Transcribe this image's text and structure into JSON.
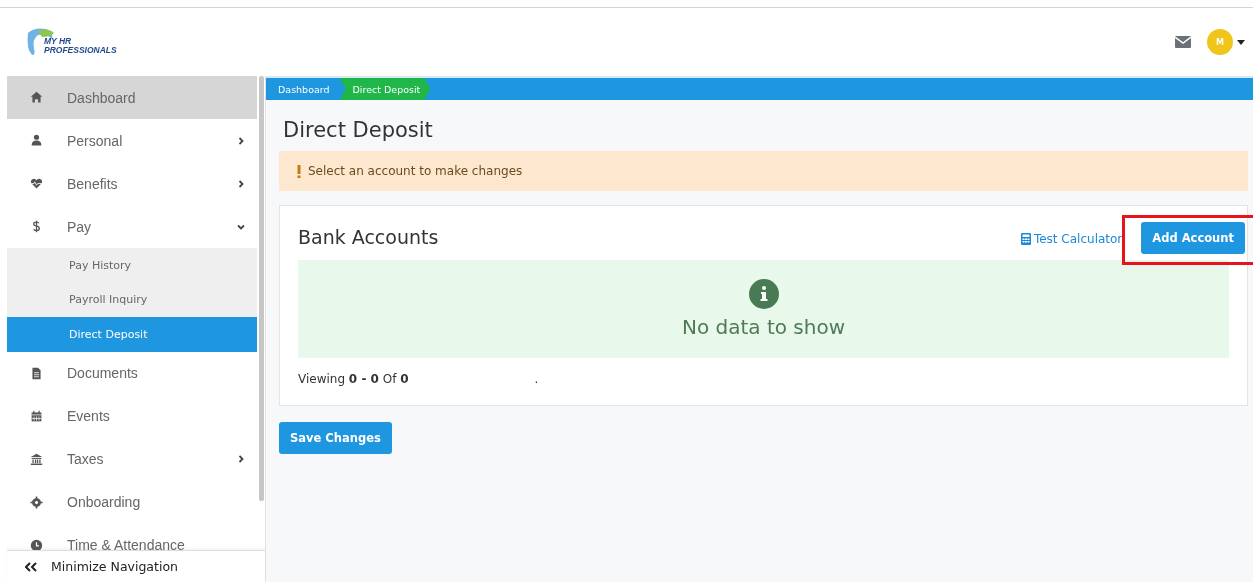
{
  "header": {
    "logo": {
      "line_1": "MY HR",
      "line_2": "PROFESSIONALS"
    },
    "avatar": "M"
  },
  "sidebar": {
    "items": [
      {
        "label": "Dashboard",
        "kind": "link",
        "highlighted": true,
        "selected": false
      },
      {
        "label": "Personal",
        "kind": "group",
        "expanded": false,
        "highlighted": false,
        "selected": false
      },
      {
        "label": "Benefits",
        "kind": "group",
        "expanded": false,
        "highlighted": false,
        "selected": false
      },
      {
        "label": "Pay",
        "kind": "group",
        "expanded": true,
        "highlighted": false,
        "selected": false,
        "children": [
          {
            "label": "Pay History",
            "selected": false
          },
          {
            "label": "Payroll Inquiry",
            "selected": false
          },
          {
            "label": "Direct Deposit",
            "selected": true
          }
        ]
      },
      {
        "label": "Documents",
        "kind": "link",
        "highlighted": false,
        "selected": false
      },
      {
        "label": "Events",
        "kind": "link",
        "highlighted": false,
        "selected": false
      },
      {
        "label": "Taxes",
        "kind": "group",
        "expanded": false,
        "highlighted": false,
        "selected": false
      },
      {
        "label": "Onboarding",
        "kind": "link",
        "highlighted": false,
        "selected": false
      },
      {
        "label": "Time & Attendance",
        "kind": "link",
        "highlighted": false,
        "selected": false
      }
    ],
    "footer": "Minimize Navigation"
  },
  "breadcrumbs": [
    {
      "label": "Dashboard",
      "selected": false
    },
    {
      "label": "Direct Deposit",
      "selected": true
    }
  ],
  "page_title": "Direct Deposit",
  "alert": "Select an account to make changes",
  "card": {
    "title": "Bank Accounts",
    "link": "Test Calculator",
    "button": {
      "label": "Add Account",
      "highlighted": true
    },
    "empty_message": "No data to show",
    "pagination": {
      "text": "Viewing **0 - 0** Of **0**",
      "column_2": "."
    }
  },
  "save_button": "Save Changes"
}
